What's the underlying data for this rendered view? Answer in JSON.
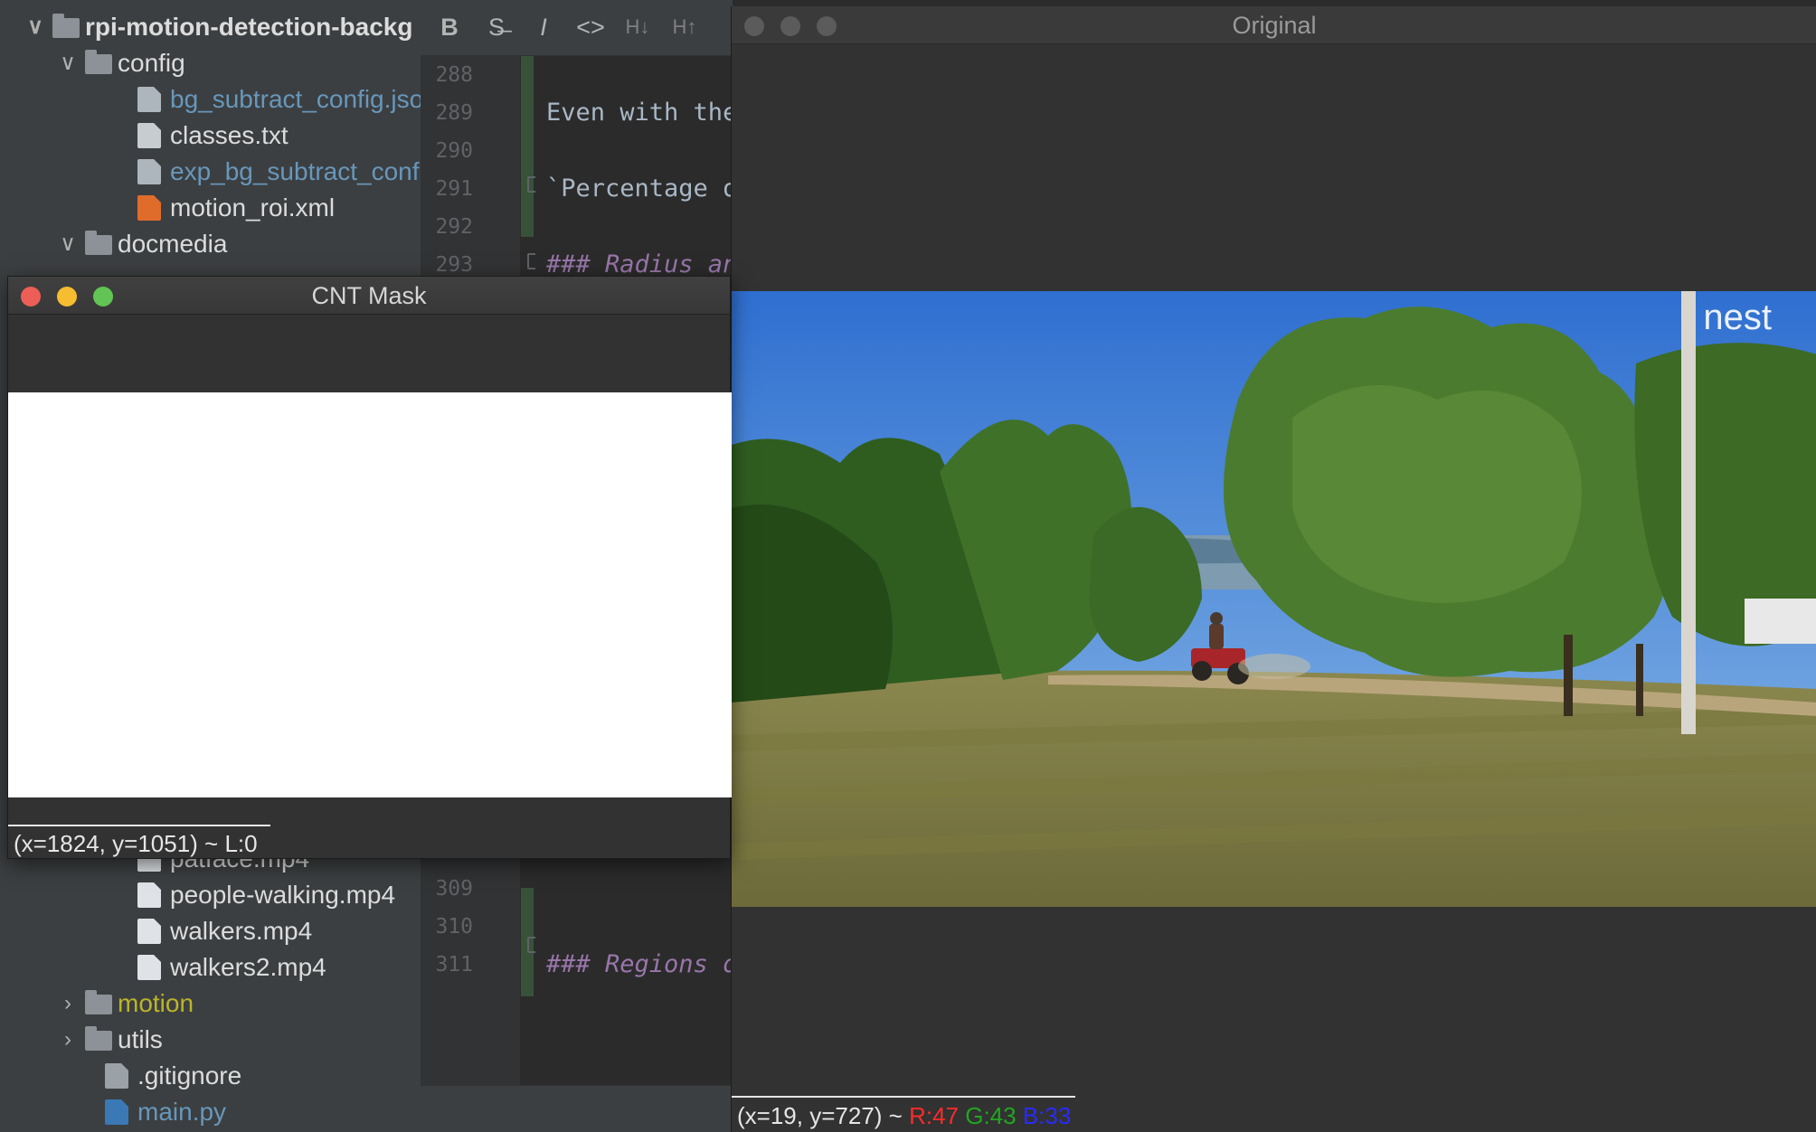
{
  "project_tree": {
    "rows": [
      {
        "label": "rpi-motion-detection-backg",
        "kind": "folder",
        "chevron": "∨",
        "color": "#dcdcdc"
      },
      {
        "label": "config",
        "kind": "folder",
        "chevron": "∨",
        "color": "#dcdcdc"
      },
      {
        "label": "bg_subtract_config.json",
        "kind": "json",
        "color": "#6897bb"
      },
      {
        "label": "classes.txt",
        "kind": "txt",
        "color": "#dcdcdc"
      },
      {
        "label": "exp_bg_subtract_config",
        "kind": "json",
        "color": "#6897bb"
      },
      {
        "label": "motion_roi.xml",
        "kind": "xml",
        "color": "#dcdcdc"
      },
      {
        "label": "docmedia",
        "kind": "folder",
        "chevron": "∨",
        "color": "#dcdcdc"
      },
      {
        "label": "patface.mp4",
        "kind": "mp4",
        "color": "#dcdcdc"
      },
      {
        "label": "people-walking.mp4",
        "kind": "mp4",
        "color": "#dcdcdc"
      },
      {
        "label": "walkers.mp4",
        "kind": "mp4",
        "color": "#dcdcdc"
      },
      {
        "label": "walkers2.mp4",
        "kind": "mp4",
        "color": "#dcdcdc"
      },
      {
        "label": "motion",
        "kind": "folder",
        "chevron": "›",
        "color": "#bbb529"
      },
      {
        "label": "utils",
        "kind": "folder",
        "chevron": "›",
        "color": "#dcdcdc"
      },
      {
        "label": ".gitignore",
        "kind": "git",
        "color": "#dcdcdc"
      },
      {
        "label": "main.py",
        "kind": "py",
        "color": "#6897bb"
      }
    ]
  },
  "editor": {
    "toolbar": [
      "B",
      "S̶",
      "I",
      "<>",
      "H↓",
      "H↑"
    ],
    "line_numbers": [
      "288",
      "289",
      "290",
      "291",
      "292",
      "293",
      "309",
      "310",
      "311"
    ],
    "code_lines": [
      {
        "text": "",
        "style": "plain"
      },
      {
        "text": "Even with the",
        "style": "plain"
      },
      {
        "text": "",
        "style": "plain"
      },
      {
        "text": "`Percentage o",
        "style": "plain"
      },
      {
        "text": "",
        "style": "plain"
      },
      {
        "text": "### Radius an",
        "style": "hd"
      },
      {
        "text": "",
        "style": "plain"
      },
      {
        "text": "",
        "style": "plain"
      },
      {
        "text": "### Regions o",
        "style": "hd"
      }
    ]
  },
  "window_original": {
    "title": "Original",
    "image_label": "nest",
    "status": {
      "coords": "(x=19, y=727) ~ ",
      "r": "R:47",
      "g": "G:43",
      "b": "B:33"
    },
    "colors": {
      "r": "#ff2a2a",
      "g": "#21a621",
      "b": "#2a2aff"
    }
  },
  "window_cnt": {
    "title": "CNT Mask",
    "status": "(x=1824, y=1051) ~ L:0"
  }
}
